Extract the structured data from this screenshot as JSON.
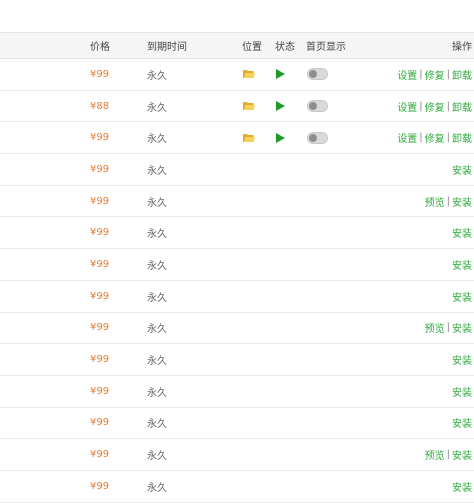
{
  "header": {
    "price": "价格",
    "expire": "到期时间",
    "location": "位置",
    "status": "状态",
    "homepage": "首页显示",
    "ops": "操作"
  },
  "labels": {
    "settings": "设置",
    "repair": "修复",
    "uninstall": "卸载",
    "preview": "预览",
    "install": "安装",
    "sep": "|"
  },
  "rows": [
    {
      "price": "¥99",
      "expire": "永久",
      "installed": true
    },
    {
      "price": "¥88",
      "expire": "永久",
      "installed": true
    },
    {
      "price": "¥99",
      "expire": "永久",
      "installed": true
    },
    {
      "price": "¥99",
      "expire": "永久",
      "installed": false,
      "preview": false
    },
    {
      "price": "¥99",
      "expire": "永久",
      "installed": false,
      "preview": true
    },
    {
      "price": "¥99",
      "expire": "永久",
      "installed": false,
      "preview": false
    },
    {
      "price": "¥99",
      "expire": "永久",
      "installed": false,
      "preview": false
    },
    {
      "price": "¥99",
      "expire": "永久",
      "installed": false,
      "preview": false
    },
    {
      "price": "¥99",
      "expire": "永久",
      "installed": false,
      "preview": true
    },
    {
      "price": "¥99",
      "expire": "永久",
      "installed": false,
      "preview": false
    },
    {
      "price": "¥99",
      "expire": "永久",
      "installed": false,
      "preview": false
    },
    {
      "price": "¥99",
      "expire": "永久",
      "installed": false,
      "preview": false
    },
    {
      "price": "¥99",
      "expire": "永久",
      "installed": false,
      "preview": true
    },
    {
      "price": "¥99",
      "expire": "永久",
      "installed": false,
      "preview": false
    }
  ],
  "colors": {
    "price": "#f07a2b",
    "link": "#2eaa3c",
    "folder": "#f0c24a",
    "play": "#1e9a2a"
  }
}
